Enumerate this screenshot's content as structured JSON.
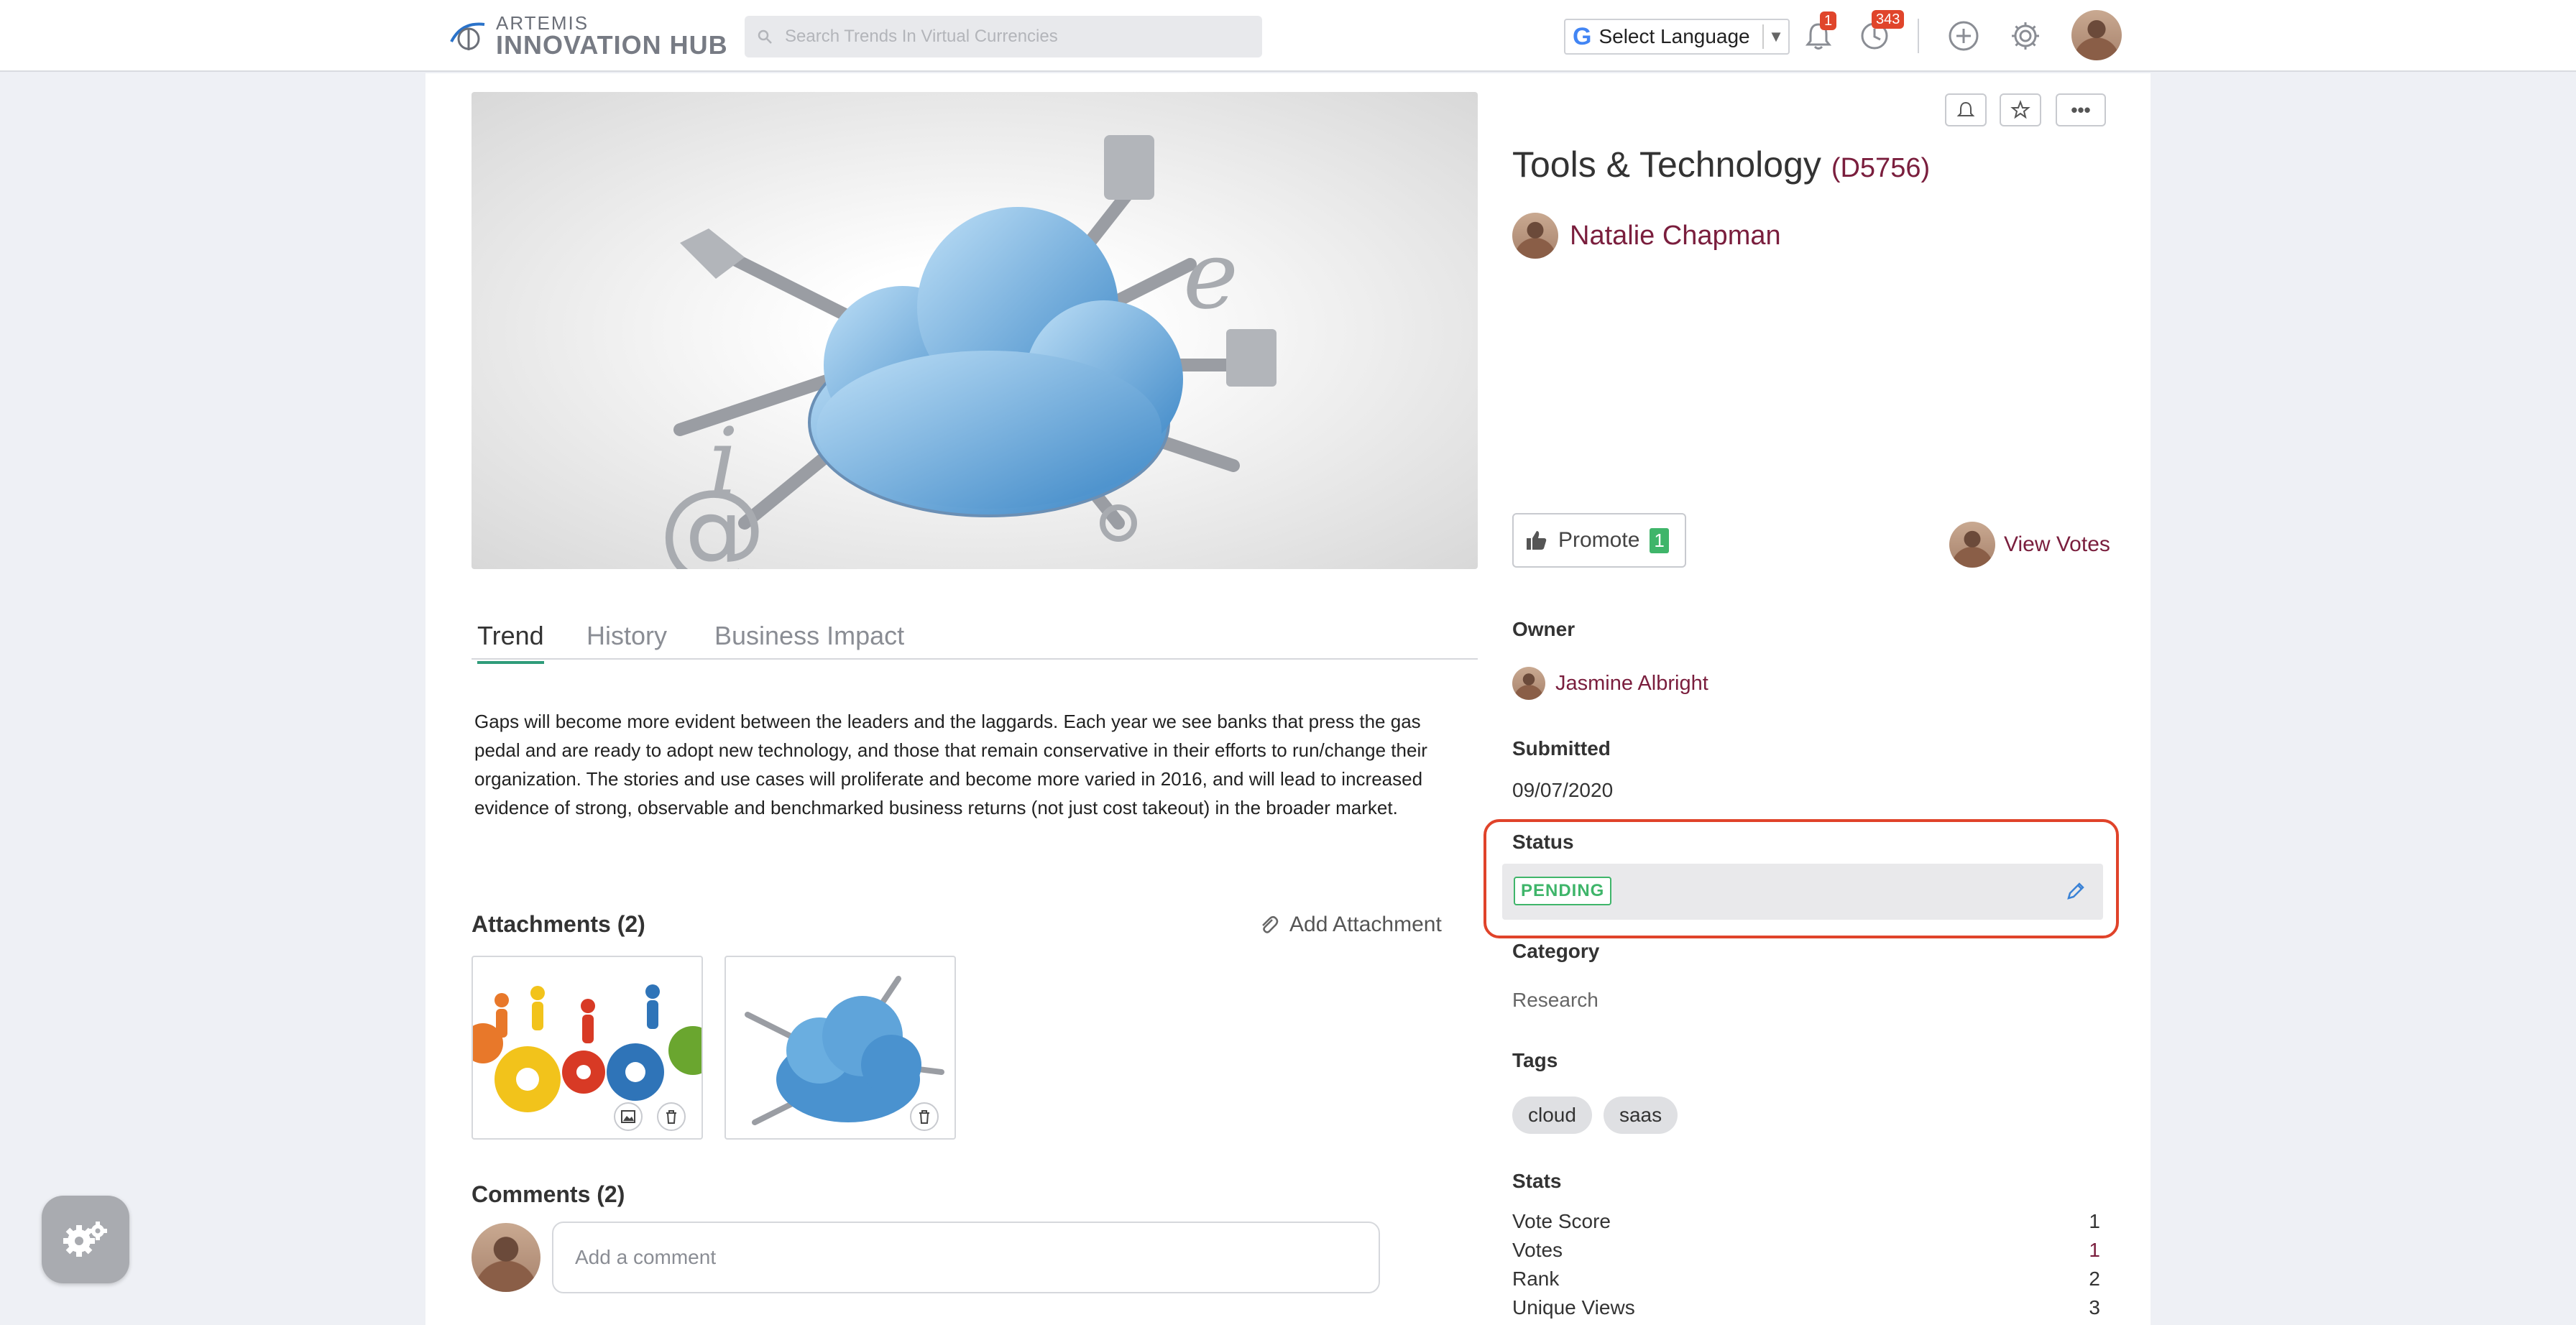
{
  "header": {
    "logo_line1": "ARTEMIS",
    "logo_line2": "INNOVATION HUB",
    "search_placeholder": "Search Trends In Virtual Currencies",
    "language_label": "Select Language",
    "notifications_count": "1",
    "activity_count": "343"
  },
  "hero": {
    "image": "cloud-with-tools-illustration"
  },
  "tabs": [
    {
      "label": "Trend",
      "active": true
    },
    {
      "label": "History",
      "active": false
    },
    {
      "label": "Business Impact",
      "active": false
    }
  ],
  "description": "Gaps will become more evident between the leaders and the laggards. Each year we see banks that press the gas pedal and are ready to adopt new technology, and those that remain conservative in their efforts to run/change their organization. The stories and use cases will proliferate and become more varied in 2016, and will lead to increased evidence of strong, observable and benchmarked business returns (not just cost takeout) in the broader market.",
  "attachments": {
    "heading": "Attachments (2)",
    "add_label": "Add Attachment"
  },
  "comments": {
    "heading": "Comments (2)",
    "placeholder": "Add a comment"
  },
  "idea": {
    "title": "Tools & Technology",
    "code": "(D5756)",
    "author": "Natalie Chapman",
    "promote_label": "Promote",
    "promote_count": "1",
    "view_votes_label": "View Votes"
  },
  "details": {
    "owner_label": "Owner",
    "owner_name": "Jasmine Albright",
    "submitted_label": "Submitted",
    "submitted_date": "09/07/2020",
    "status_label": "Status",
    "status_value": "PENDING",
    "category_label": "Category",
    "category_value": "Research",
    "tags_label": "Tags",
    "tags": [
      "cloud",
      "saas"
    ],
    "stats_label": "Stats",
    "stats": [
      {
        "label": "Vote Score",
        "value": "1"
      },
      {
        "label": "Votes",
        "value": "1"
      },
      {
        "label": "Rank",
        "value": "2"
      },
      {
        "label": "Unique Views",
        "value": "3"
      }
    ]
  },
  "colors": {
    "accent_link": "#7a1e3d",
    "tab_underline": "#2f9c7a",
    "status_green": "#3fb56a",
    "highlight_red": "#e0432a",
    "badge_red": "#e0452b"
  }
}
